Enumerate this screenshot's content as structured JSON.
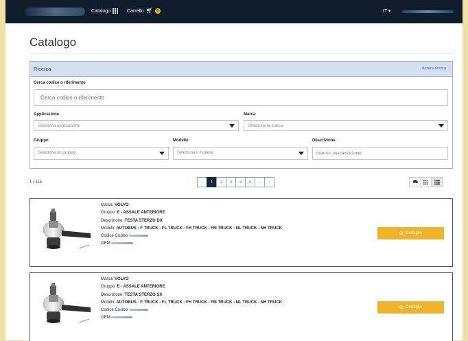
{
  "header": {
    "nav": {
      "catalogo": "Catalogo",
      "carrello": "Carrello",
      "cart_count": "0"
    },
    "language": "IT ▾"
  },
  "page": {
    "title": "Catalogo"
  },
  "search": {
    "title": "Ricerca",
    "reset": "Azzera ricerca",
    "code": {
      "label": "Cerca codice o riferimento",
      "placeholder": "Cerca codice o riferimento"
    },
    "applicazione": {
      "label": "Applicazione",
      "value": "Seleziona applicazione"
    },
    "marca": {
      "label": "Marca",
      "value": "Seleziona la marca"
    },
    "gruppo": {
      "label": "Gruppo",
      "value": "Seleziona un gruppo"
    },
    "modello": {
      "label": "Modello",
      "value": "Seleziona il modello"
    },
    "descrizione": {
      "label": "Descrizione",
      "placeholder": "Inserisci una descrizione"
    }
  },
  "results": {
    "count": "1 / 114",
    "pagination": [
      "‹",
      "1",
      "2",
      "3",
      "4",
      "5",
      "...",
      "›"
    ],
    "active_page": "1"
  },
  "products": [
    {
      "marca_label": "Marca:",
      "marca": "VOLVO",
      "gruppo_label": "Gruppo:",
      "gruppo": "E - ASSALE ANTERIORE",
      "descr_label": "Descrizione:",
      "descrizione": "TESTA STERZO DX",
      "modelli_label": "Modelli:",
      "modelli": "AUTOBUS - F TRUCK - FL TRUCK - FH TRUCK - FM TRUCK - NL TRUCK - NH TRUCK",
      "cosibo_label": "Codice Cosibo:",
      "oem_label": "OEM:",
      "button": "Dettaglio"
    },
    {
      "marca_label": "Marca:",
      "marca": "VOLVO",
      "gruppo_label": "Gruppo:",
      "gruppo": "E - ASSALE ANTERIORE",
      "descr_label": "Descrizione:",
      "descrizione": "TESTA STERZO SX",
      "modelli_label": "Modelli:",
      "modelli": "AUTOBUS - F TRUCK - FL TRUCK - FH TRUCK - FM TRUCK - NL TRUCK - NH TRUCK",
      "cosibo_label": "Codice Cosibo:",
      "oem_label": "OEM",
      "button": "Dettaglio"
    }
  ],
  "colors": {
    "navbar": "#0f1d2c",
    "accent": "#f0b42b",
    "panel_header": "#d3dff0",
    "link": "#2d6db5"
  },
  "icons": [
    "grid-icon",
    "cart-icon",
    "search-icon",
    "download-icon",
    "grid-view-icon",
    "list-view-icon"
  ]
}
